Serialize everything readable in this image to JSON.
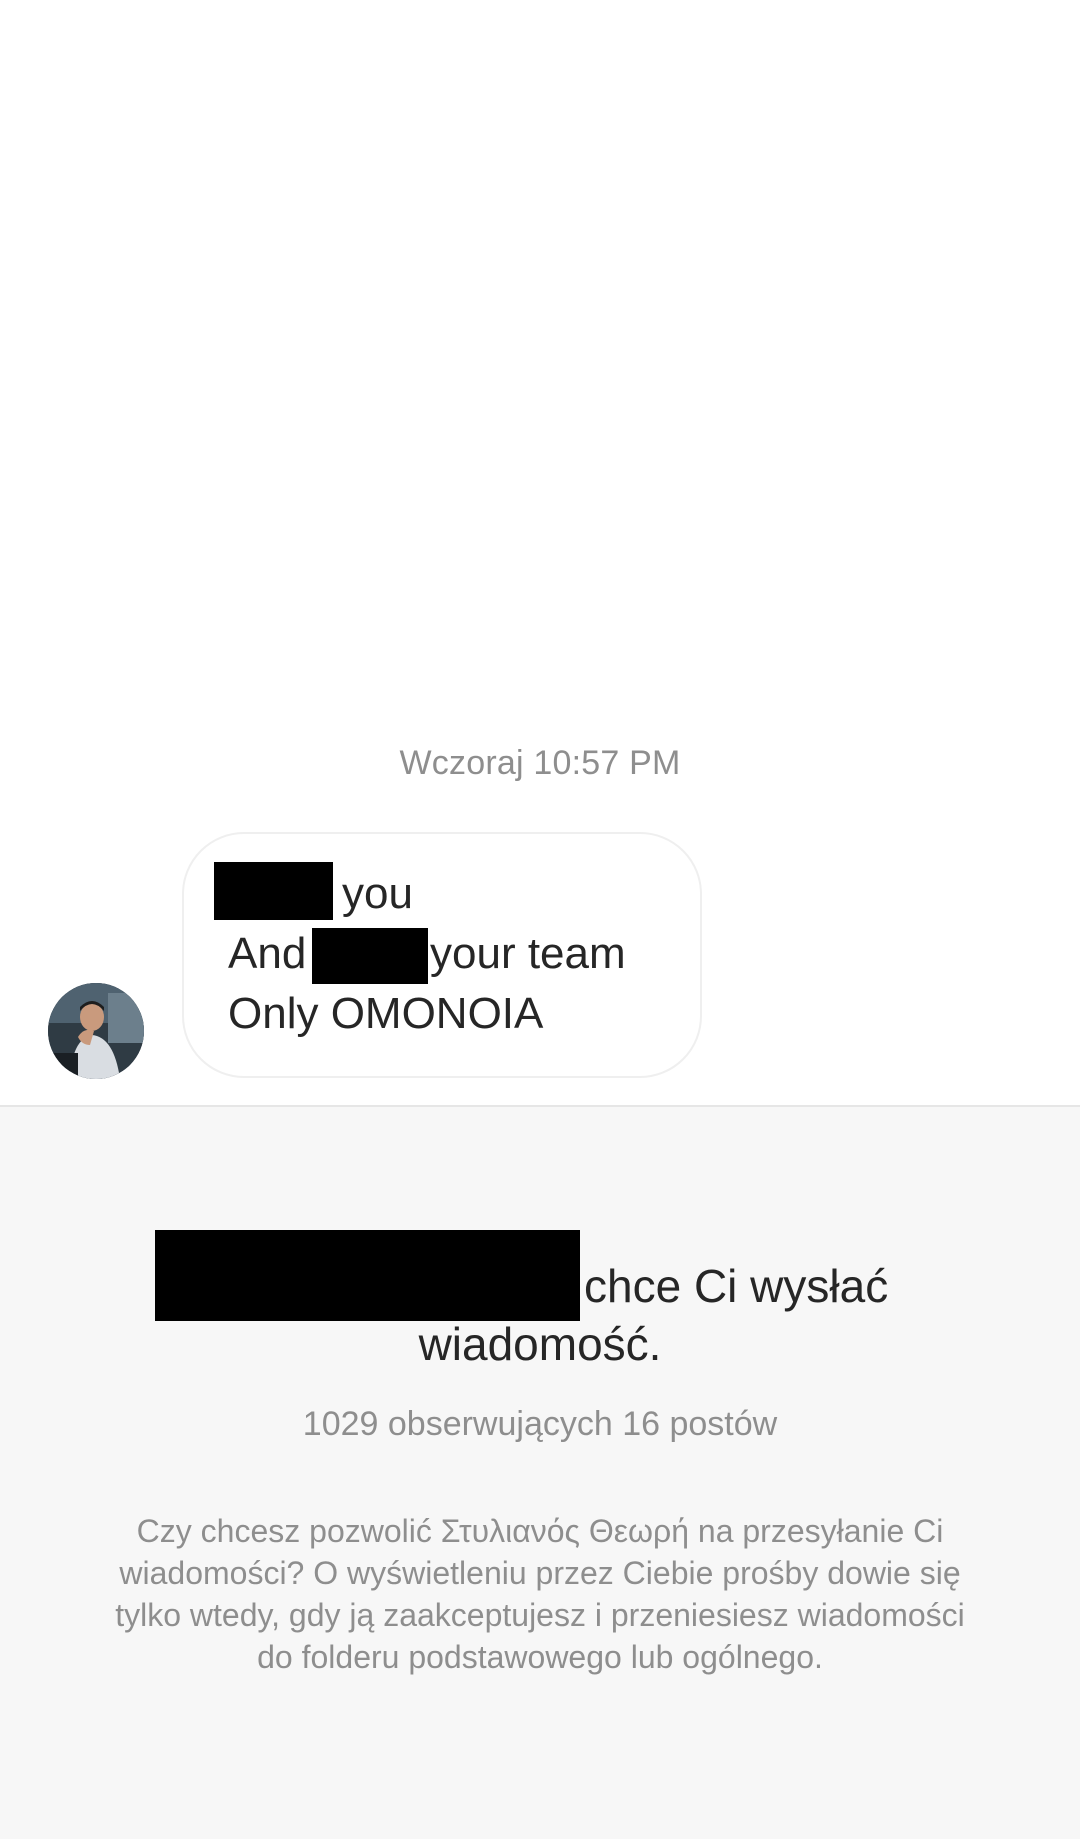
{
  "chat": {
    "timestamp": "Wczoraj 10:57 PM",
    "message": {
      "line1_after_redaction": "you",
      "line2_before_redaction": "And",
      "line2_after_redaction": "your team",
      "line3": "Only OMONOIA"
    },
    "avatar_icon": "profile-photo"
  },
  "request": {
    "title_after_redaction": "chce Ci wysłać",
    "title_line2": "wiadomość.",
    "stats": "1029 obserwujących 16 postów",
    "description": "Czy chcesz pozwolić Στυλιανός Θεωρή na przesyłanie Ci wiadomości? O wyświetleniu przez Ciebie prośby dowie się tylko wtedy, gdy ją zaakceptujesz i przeniesiesz wiadomości do folderu podstawowego lub ogólnego."
  },
  "colors": {
    "primary_text": "#262626",
    "secondary_text": "#8e8e8e",
    "panel_bg": "#f7f7f7",
    "redaction": "#000000"
  }
}
